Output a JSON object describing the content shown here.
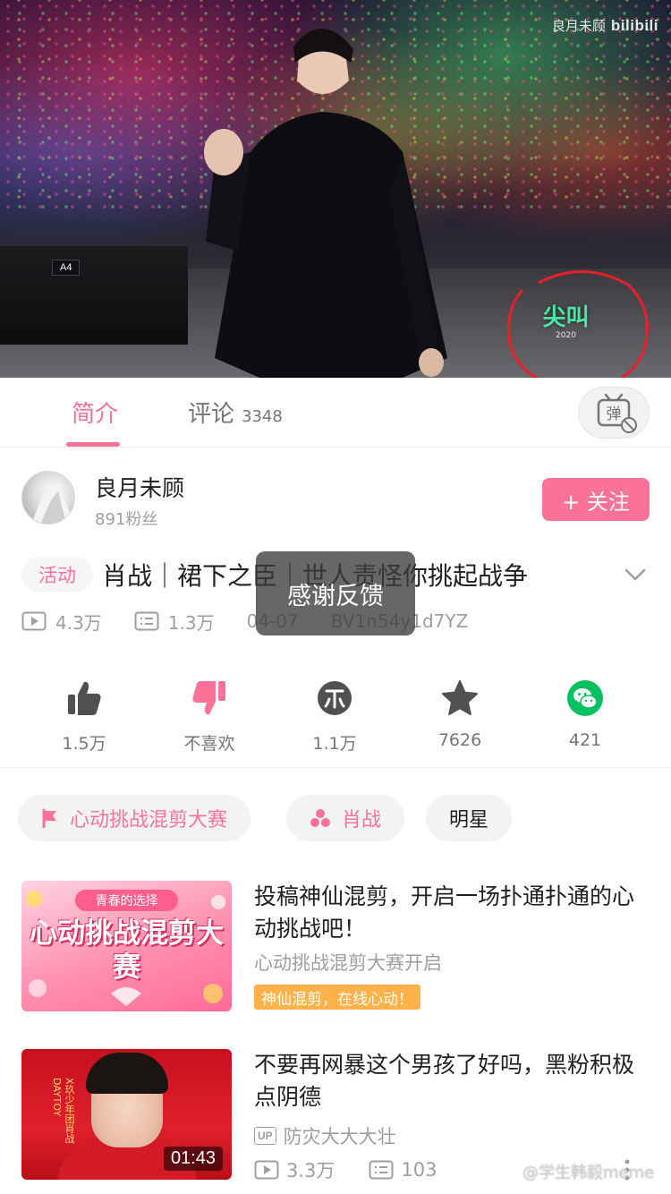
{
  "video": {
    "watermark_uploader": "良月未顾",
    "watermark_brand": "bilibili",
    "barrier_label": "A4",
    "logo_text_big": "尖叫",
    "logo_text_small": "2020"
  },
  "tabs": {
    "intro_label": "简介",
    "comments_label": "评论",
    "comments_count": "3348",
    "danmaku_label": "弹"
  },
  "uploader": {
    "name": "良月未顾",
    "fans": "891粉丝",
    "follow_label": "+ 关注"
  },
  "title": {
    "activity_tag": "活动",
    "text": "肖战｜裙下之臣｜世人责怪你挑起战争"
  },
  "stats": {
    "views": "4.3万",
    "danmaku": "1.3万",
    "date": "04-07",
    "bvid": "BV1n54y1d7YZ"
  },
  "toast": "感谢反馈",
  "actions": [
    {
      "icon": "thumbs-up-icon",
      "label": "1.5万",
      "color": "#505050"
    },
    {
      "icon": "thumbs-down-icon",
      "label": "不喜欢",
      "color": "#fb7299"
    },
    {
      "icon": "coin-icon",
      "label": "1.1万",
      "color": "#505050"
    },
    {
      "icon": "star-icon",
      "label": "7626",
      "color": "#505050"
    },
    {
      "icon": "wechat-icon",
      "label": "421",
      "color": "#07c160"
    }
  ],
  "tags": [
    {
      "label": "心动挑战混剪大赛",
      "icon": "flag-icon"
    },
    {
      "label": "肖战",
      "icon": "dots-icon"
    },
    {
      "label": "明星",
      "icon": ""
    }
  ],
  "recommendations": [
    {
      "title": "投稿神仙混剪，开启一场扑通扑通的心动挑战吧！",
      "subtitle": "心动挑战混剪大赛开启",
      "badge": "神仙混剪，在线心动！",
      "thumb_banner": "青春的选择",
      "thumb_text": "心动挑战混剪大赛"
    },
    {
      "title": "不要再网暴这个男孩了好吗，黑粉积极点阴德",
      "uploader": "防灾大大大壮",
      "views": "3.3万",
      "danmaku": "103",
      "duration": "01:43",
      "thumb_side_text": "X玖少年团肖战DAYTOY"
    }
  ],
  "weibo_watermark": "@学生韩毅meme",
  "colors": {
    "accent": "#fb7299",
    "badge": "#ffb24a",
    "wechat": "#07c160"
  }
}
